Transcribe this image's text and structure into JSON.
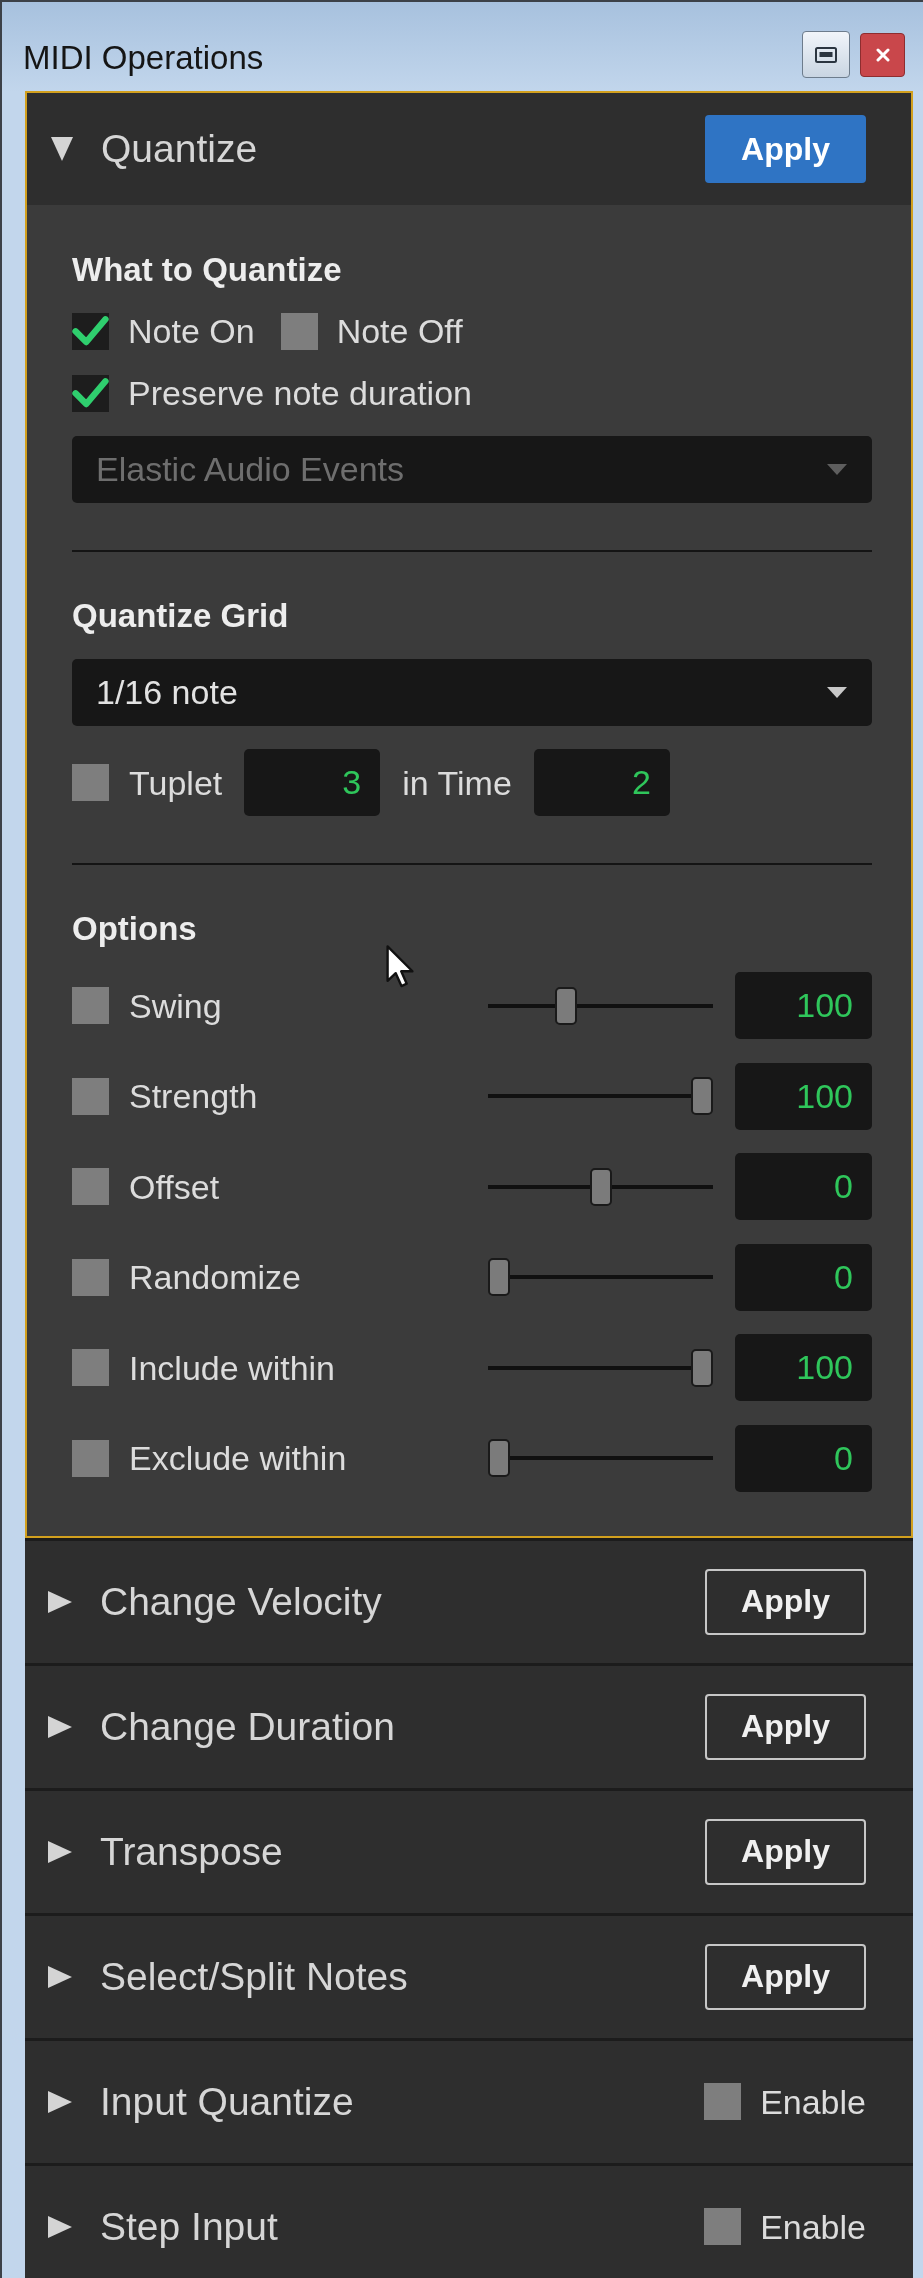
{
  "window": {
    "title": "MIDI Operations"
  },
  "sections": [
    {
      "title": "Quantize",
      "expanded": true,
      "action": {
        "kind": "button",
        "label": "Apply"
      },
      "body": {
        "what_to_quantize": {
          "heading": "What to Quantize",
          "checkbox_rows": [
            [
              {
                "label": "Note On",
                "checked": true
              },
              {
                "label": "Note Off",
                "checked": false
              }
            ],
            [
              {
                "label": "Preserve note duration",
                "checked": true
              }
            ]
          ],
          "dropdown": {
            "value": "Elastic Audio Events",
            "disabled": true
          }
        },
        "quantize_grid": {
          "heading": "Quantize Grid",
          "dropdown": {
            "value": "1/16 note",
            "disabled": false
          },
          "tuplet": {
            "label": "Tuplet",
            "checked": false,
            "value": "3",
            "in_time_label": "in Time",
            "in_time_value": "2"
          }
        },
        "options": {
          "heading": "Options",
          "rows": [
            {
              "label": "Swing",
              "checked": false,
              "level": 0.33,
              "value": "100"
            },
            {
              "label": "Strength",
              "checked": false,
              "level": 1,
              "value": "100"
            },
            {
              "label": "Offset",
              "checked": false,
              "level": 0.5,
              "value": "0"
            },
            {
              "label": "Randomize",
              "checked": false,
              "level": 0,
              "value": "0"
            },
            {
              "label": "Include within",
              "checked": false,
              "level": 1,
              "value": "100"
            },
            {
              "label": "Exclude within",
              "checked": false,
              "level": 0,
              "value": "0"
            }
          ]
        }
      }
    },
    {
      "title": "Change Velocity",
      "expanded": false,
      "action": {
        "kind": "button",
        "label": "Apply"
      }
    },
    {
      "title": "Change Duration",
      "expanded": false,
      "action": {
        "kind": "button",
        "label": "Apply"
      }
    },
    {
      "title": "Transpose",
      "expanded": false,
      "action": {
        "kind": "button",
        "label": "Apply"
      }
    },
    {
      "title": "Select/Split Notes",
      "expanded": false,
      "action": {
        "kind": "button",
        "label": "Apply"
      }
    },
    {
      "title": "Input Quantize",
      "expanded": false,
      "action": {
        "kind": "checkbox",
        "label": "Enable",
        "checked": false
      }
    },
    {
      "title": "Step Input",
      "expanded": false,
      "action": {
        "kind": "checkbox",
        "label": "Enable",
        "checked": false
      }
    }
  ]
}
